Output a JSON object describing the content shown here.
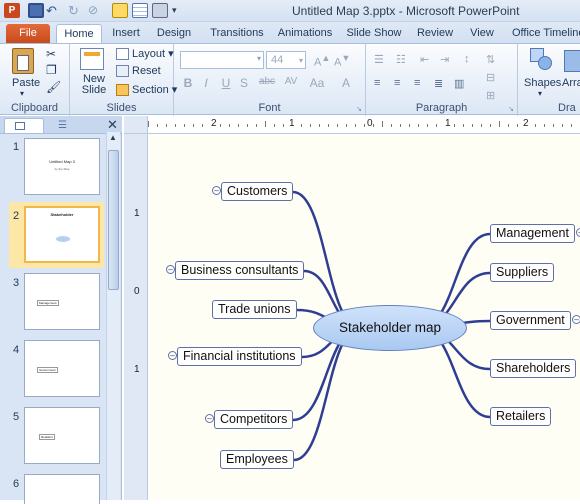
{
  "window": {
    "title": "Untitled Map 3.pptx  -  Microsoft PowerPoint"
  },
  "tabs": [
    "File",
    "Home",
    "Insert",
    "Design",
    "Transitions",
    "Animations",
    "Slide Show",
    "Review",
    "View",
    "Office Timeline"
  ],
  "ribbon": {
    "clipboard": {
      "label": "Clipboard",
      "paste": "Paste"
    },
    "slides": {
      "label": "Slides",
      "new_slide": "New Slide",
      "layout": "Layout",
      "reset": "Reset",
      "section": "Section"
    },
    "font": {
      "label": "Font",
      "size": "44",
      "bold": "B",
      "italic": "I",
      "underline": "U",
      "shadow": "S",
      "strike": "abc",
      "spacing": "AV",
      "case": "Aa",
      "color": "A"
    },
    "paragraph": {
      "label": "Paragraph"
    },
    "drawing": {
      "label": "Dra",
      "shapes": "Shapes",
      "arrange": "Arra"
    }
  },
  "ruler": {
    "h_ticks": [
      "2",
      "1",
      "0",
      "1",
      "2"
    ],
    "v_ticks": [
      "1",
      "0",
      "1"
    ]
  },
  "thumbnails": [
    {
      "num": "1",
      "title": "Untitled Map 3",
      "sub": "by the Map"
    },
    {
      "num": "2",
      "title": "Stakeholder"
    },
    {
      "num": "3",
      "label": "Management"
    },
    {
      "num": "4",
      "label": "Government"
    },
    {
      "num": "5",
      "label": "Retailers"
    },
    {
      "num": "6"
    }
  ],
  "map": {
    "center": "Stakeholder map",
    "left": [
      "Customers",
      "Business consultants",
      "Trade unions",
      "Financial institutions",
      "Competitors",
      "Employees"
    ],
    "right": [
      "Management",
      "Suppliers",
      "Government",
      "Shareholders",
      "Retailers"
    ]
  }
}
